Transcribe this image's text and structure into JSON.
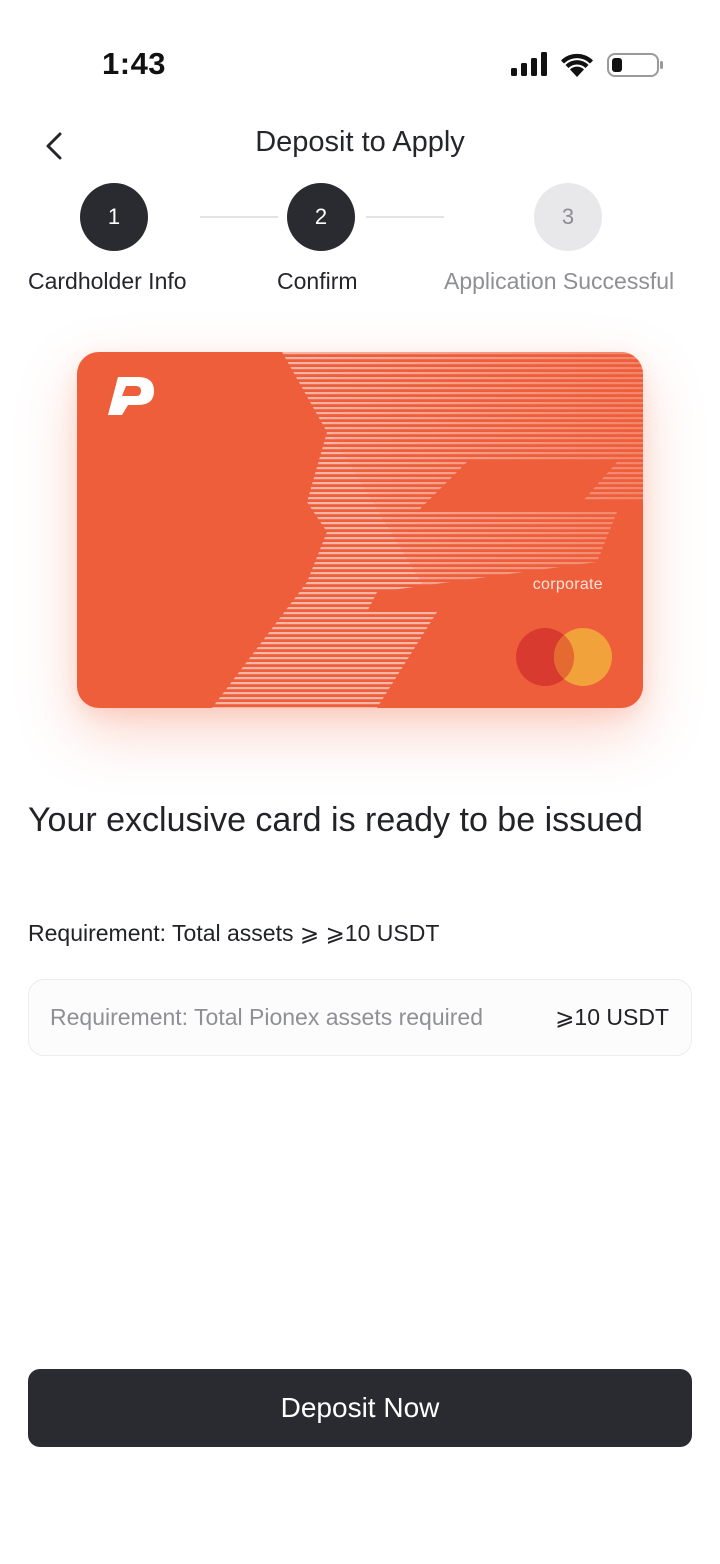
{
  "status_bar": {
    "time": "1:43"
  },
  "header": {
    "title": "Deposit to Apply"
  },
  "stepper": {
    "steps": [
      {
        "number": "1",
        "label": "Cardholder Info",
        "state": "done"
      },
      {
        "number": "2",
        "label": "Confirm",
        "state": "active"
      },
      {
        "number": "3",
        "label": "Application Successful",
        "state": "todo"
      }
    ]
  },
  "card": {
    "tier": "corporate",
    "brand_color": "#ee5e3b",
    "network": "mastercard-icon"
  },
  "content": {
    "headline": "Your exclusive card is ready to be issued",
    "requirement": "Requirement: Total assets ⩾ ⩾10 USDT",
    "requirement_box": {
      "label": "Requirement: Total Pionex assets required",
      "value": "⩾10 USDT"
    }
  },
  "actions": {
    "deposit_label": "Deposit Now"
  },
  "colors": {
    "primary_dark": "#2a2b30",
    "inactive_step": "#e8e8ea",
    "muted_text": "#8e8f94"
  }
}
